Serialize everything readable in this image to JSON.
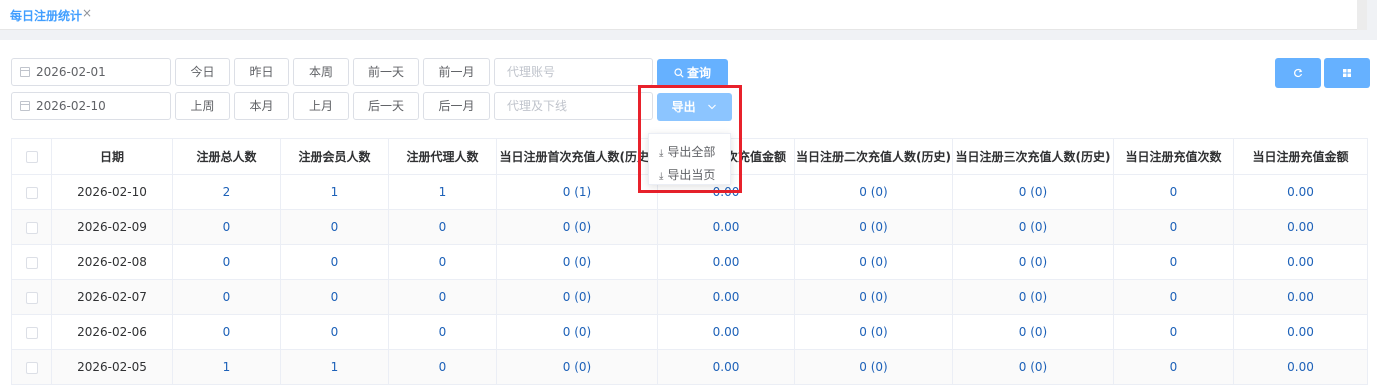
{
  "tab": {
    "title": "每日注册统计",
    "close": "×"
  },
  "filters": {
    "start_date": "2026-02-01",
    "end_date": "2026-02-10",
    "row1_buttons": [
      "今日",
      "昨日",
      "本周",
      "前一天",
      "前一月"
    ],
    "row2_buttons": [
      "上周",
      "本月",
      "上月",
      "后一天",
      "后一月"
    ],
    "agent_account_placeholder": "代理账号",
    "agent_downline_placeholder": "代理及下线",
    "query_label": "查询",
    "export_label": "导出"
  },
  "export_menu": [
    "导出全部",
    "导出当页"
  ],
  "table": {
    "headers": [
      "日期",
      "注册总人数",
      "注册会员人数",
      "注册代理人数",
      "当日注册首次充值人数(历史)",
      "当日注册首次充值金额",
      "当日注册二次充值人数(历史)",
      "当日注册三次充值人数(历史)",
      "当日注册充值次数",
      "当日注册充值金额"
    ],
    "rows": [
      [
        "2026-02-10",
        "2",
        "1",
        "1",
        "0 (1)",
        "0.00",
        "0 (0)",
        "0 (0)",
        "0",
        "0.00"
      ],
      [
        "2026-02-09",
        "0",
        "0",
        "0",
        "0 (0)",
        "0.00",
        "0 (0)",
        "0 (0)",
        "0",
        "0.00"
      ],
      [
        "2026-02-08",
        "0",
        "0",
        "0",
        "0 (0)",
        "0.00",
        "0 (0)",
        "0 (0)",
        "0",
        "0.00"
      ],
      [
        "2026-02-07",
        "0",
        "0",
        "0",
        "0 (0)",
        "0.00",
        "0 (0)",
        "0 (0)",
        "0",
        "0.00"
      ],
      [
        "2026-02-06",
        "0",
        "0",
        "0",
        "0 (0)",
        "0.00",
        "0 (0)",
        "0 (0)",
        "0",
        "0.00"
      ],
      [
        "2026-02-05",
        "1",
        "1",
        "0",
        "0 (0)",
        "0.00",
        "0 (0)",
        "0 (0)",
        "0",
        "0.00"
      ]
    ]
  },
  "colors": {
    "primary": "#66b1ff",
    "link_value": "#1d61b8",
    "highlight": "#e8212b"
  }
}
